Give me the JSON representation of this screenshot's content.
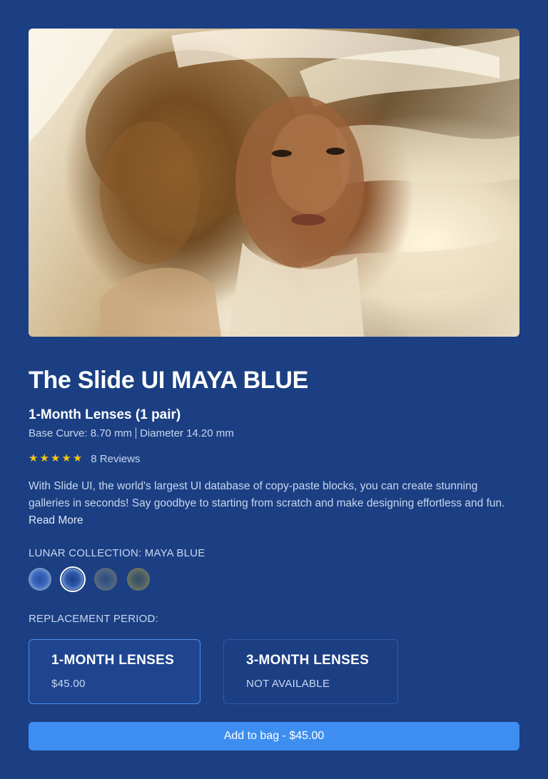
{
  "product": {
    "image_alt": "Model with curly hair and flowing white fabric",
    "title": "The Slide UI MAYA BLUE",
    "subtitle": "1-Month Lenses (1 pair)",
    "base_curve": "Base Curve: 8.70 mm",
    "diameter": "Diameter 14.20 mm",
    "rating": 5,
    "reviews": "8 Reviews",
    "description": "With Slide UI, the world's largest UI database of copy-paste blocks, you can create stunning galleries in seconds! Say goodbye to starting from scratch and make designing effortless and fun. ",
    "read_more": "Read More"
  },
  "collection": {
    "label": "LUNAR COLLECTION: MAYA BLUE",
    "selected_index": 1,
    "swatches": [
      "maya-blue-light",
      "maya-blue",
      "grey-blue",
      "olive-grey"
    ]
  },
  "replacement": {
    "label": "REPLACEMENT PERIOD:",
    "options": [
      {
        "name": "1-MONTH LENSES",
        "price": "$45.00",
        "selected": true
      },
      {
        "name": "3-MONTH LENSES",
        "price": "NOT AVAILABLE",
        "selected": false
      }
    ]
  },
  "cta": {
    "label": "Add to bag - $45.00"
  },
  "colors": {
    "background": "#1b3f82",
    "accent": "#3d8ef0",
    "star": "#f5c518"
  }
}
